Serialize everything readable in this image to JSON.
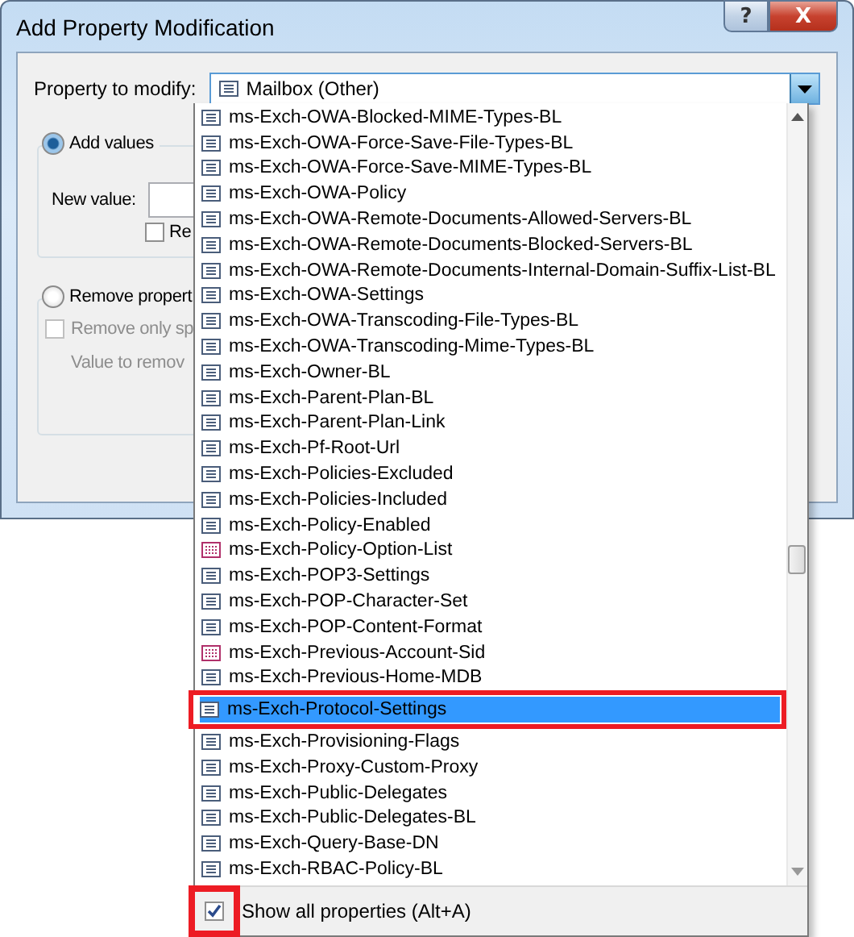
{
  "window": {
    "title": "Add Property Modification",
    "buttons": [
      {
        "kind": "help",
        "label": "?"
      },
      {
        "kind": "close",
        "label": "X"
      }
    ]
  },
  "property_to_modify": {
    "label": "Property to modify:",
    "value": "Mailbox (Other)",
    "expanded": true
  },
  "add_values": {
    "label": "Add values",
    "selected": true,
    "new_value_label": "New value:",
    "checkbox_label": "Re",
    "checked": false
  },
  "remove_property": {
    "label": "Remove propert",
    "selected": false,
    "checkbox_label": "Remove only sp",
    "checked": false,
    "disabled": true,
    "value_label": "Value to remov"
  },
  "dropdown": {
    "items": [
      {
        "label": "ms-Exch-OWA-Blocked-MIME-Types-BL",
        "kind": "single",
        "selected": false,
        "highlighted": false
      },
      {
        "label": "ms-Exch-OWA-Force-Save-File-Types-BL",
        "kind": "single",
        "selected": false,
        "highlighted": false
      },
      {
        "label": "ms-Exch-OWA-Force-Save-MIME-Types-BL",
        "kind": "single",
        "selected": false,
        "highlighted": false
      },
      {
        "label": "ms-Exch-OWA-Policy",
        "kind": "single",
        "selected": false,
        "highlighted": false
      },
      {
        "label": "ms-Exch-OWA-Remote-Documents-Allowed-Servers-BL",
        "kind": "single",
        "selected": false,
        "highlighted": false
      },
      {
        "label": "ms-Exch-OWA-Remote-Documents-Blocked-Servers-BL",
        "kind": "single",
        "selected": false,
        "highlighted": false
      },
      {
        "label": "ms-Exch-OWA-Remote-Documents-Internal-Domain-Suffix-List-BL",
        "kind": "single",
        "selected": false,
        "highlighted": false
      },
      {
        "label": "ms-Exch-OWA-Settings",
        "kind": "single",
        "selected": false,
        "highlighted": false
      },
      {
        "label": "ms-Exch-OWA-Transcoding-File-Types-BL",
        "kind": "single",
        "selected": false,
        "highlighted": false
      },
      {
        "label": "ms-Exch-OWA-Transcoding-Mime-Types-BL",
        "kind": "single",
        "selected": false,
        "highlighted": false
      },
      {
        "label": "ms-Exch-Owner-BL",
        "kind": "single",
        "selected": false,
        "highlighted": false
      },
      {
        "label": "ms-Exch-Parent-Plan-BL",
        "kind": "single",
        "selected": false,
        "highlighted": false
      },
      {
        "label": "ms-Exch-Parent-Plan-Link",
        "kind": "single",
        "selected": false,
        "highlighted": false
      },
      {
        "label": "ms-Exch-Pf-Root-Url",
        "kind": "single",
        "selected": false,
        "highlighted": false
      },
      {
        "label": "ms-Exch-Policies-Excluded",
        "kind": "single",
        "selected": false,
        "highlighted": false
      },
      {
        "label": "ms-Exch-Policies-Included",
        "kind": "single",
        "selected": false,
        "highlighted": false
      },
      {
        "label": "ms-Exch-Policy-Enabled",
        "kind": "single",
        "selected": false,
        "highlighted": false
      },
      {
        "label": "ms-Exch-Policy-Option-List",
        "kind": "multi",
        "selected": false,
        "highlighted": false
      },
      {
        "label": "ms-Exch-POP3-Settings",
        "kind": "single",
        "selected": false,
        "highlighted": false
      },
      {
        "label": "ms-Exch-POP-Character-Set",
        "kind": "single",
        "selected": false,
        "highlighted": false
      },
      {
        "label": "ms-Exch-POP-Content-Format",
        "kind": "single",
        "selected": false,
        "highlighted": false
      },
      {
        "label": "ms-Exch-Previous-Account-Sid",
        "kind": "multi",
        "selected": false,
        "highlighted": false
      },
      {
        "label": "ms-Exch-Previous-Home-MDB",
        "kind": "single",
        "selected": false,
        "highlighted": false
      },
      {
        "label": "ms-Exch-Protocol-Settings",
        "kind": "single",
        "selected": true,
        "highlighted": true
      },
      {
        "label": "ms-Exch-Provisioning-Flags",
        "kind": "single",
        "selected": false,
        "highlighted": false
      },
      {
        "label": "ms-Exch-Proxy-Custom-Proxy",
        "kind": "single",
        "selected": false,
        "highlighted": false
      },
      {
        "label": "ms-Exch-Public-Delegates",
        "kind": "single",
        "selected": false,
        "highlighted": false
      },
      {
        "label": "ms-Exch-Public-Delegates-BL",
        "kind": "single",
        "selected": false,
        "highlighted": false
      },
      {
        "label": "ms-Exch-Query-Base-DN",
        "kind": "single",
        "selected": false,
        "highlighted": false
      },
      {
        "label": "ms-Exch-RBAC-Policy-BL",
        "kind": "single",
        "selected": false,
        "highlighted": false
      }
    ],
    "show_all": {
      "label": "Show all properties (Alt+A)",
      "checked": true,
      "highlighted": true
    }
  }
}
